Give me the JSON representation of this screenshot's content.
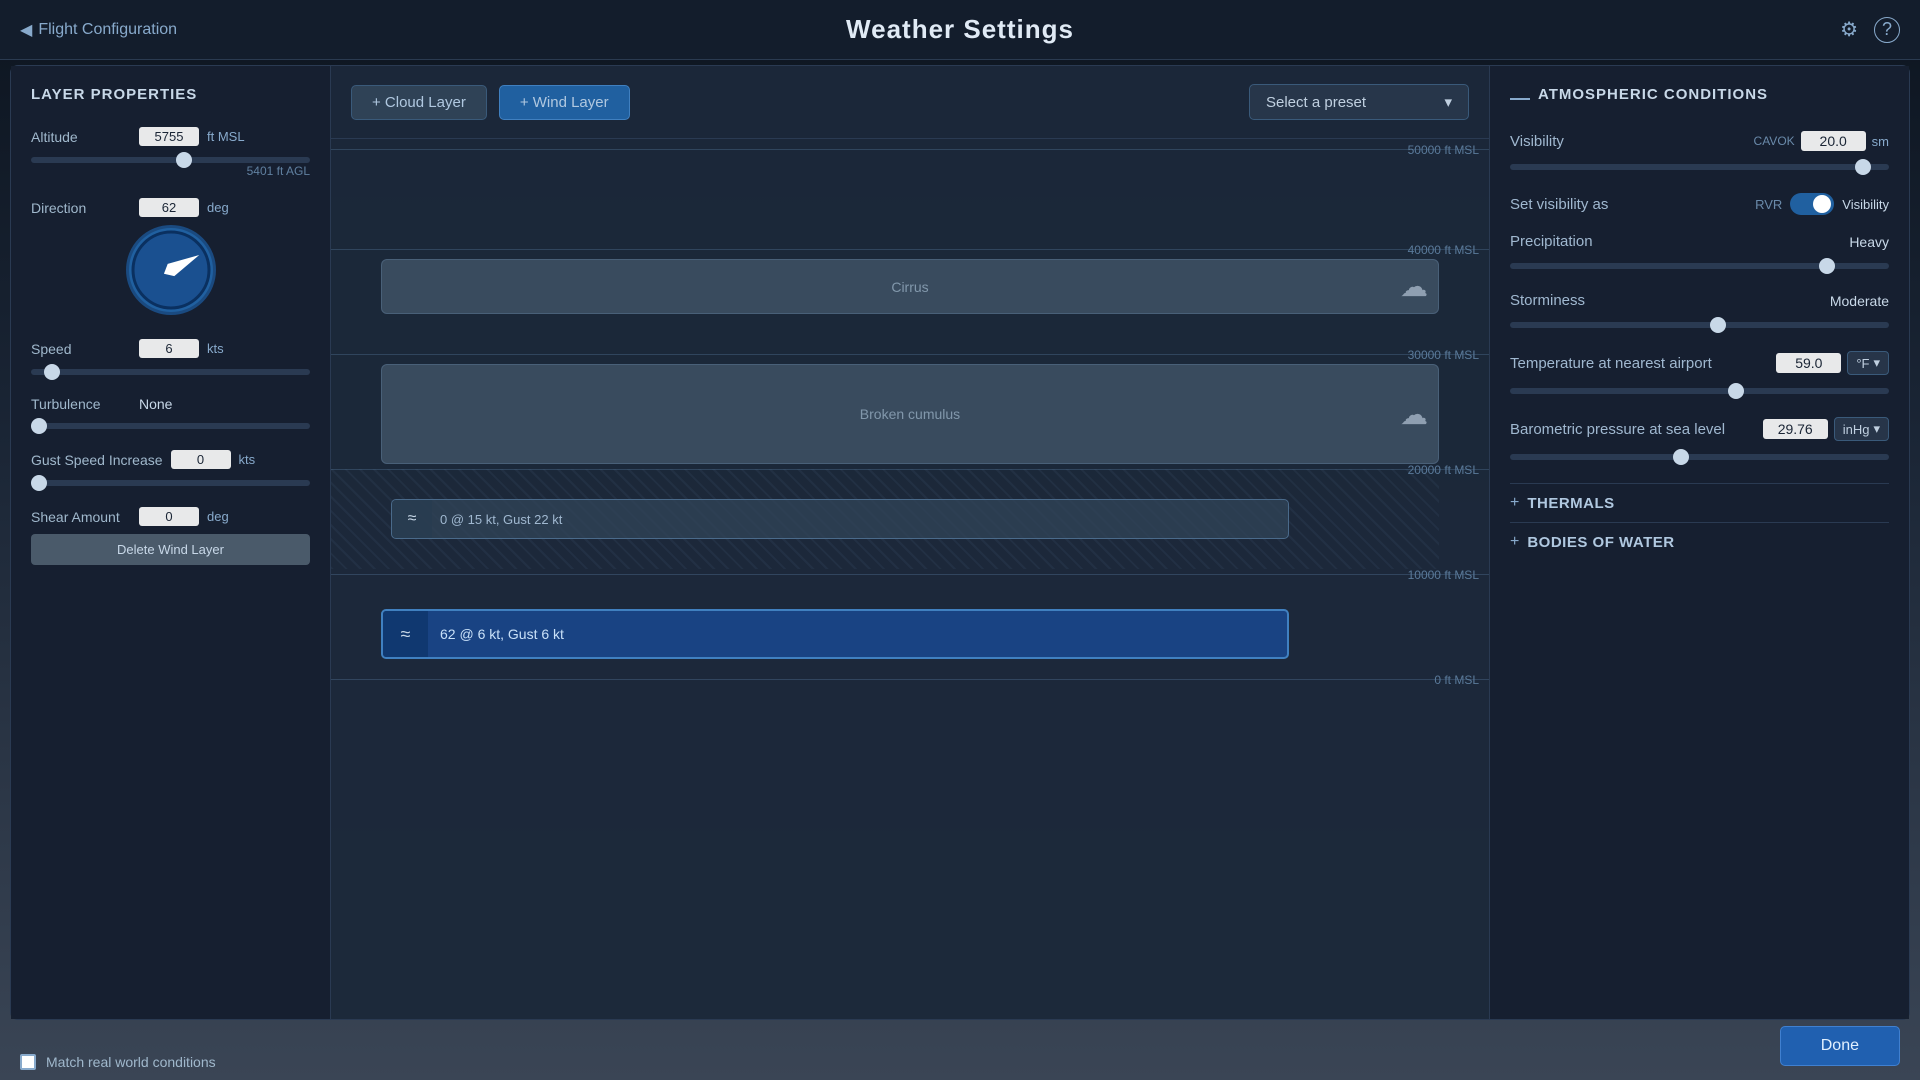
{
  "topBar": {
    "backLabel": "Flight Configuration",
    "title": "Weather Settings",
    "backIcon": "◀"
  },
  "leftPanel": {
    "sectionTitle": "LAYER PROPERTIES",
    "altitude": {
      "label": "Altitude",
      "value": "5755",
      "unit": "ft MSL",
      "subLabel": "5401 ft AGL",
      "sliderPercent": 55
    },
    "direction": {
      "label": "Direction",
      "value": "62",
      "unit": "deg",
      "compassAngle": 62
    },
    "speed": {
      "label": "Speed",
      "value": "6",
      "unit": "kts",
      "sliderPercent": 5
    },
    "turbulence": {
      "label": "Turbulence",
      "value": "None",
      "sliderPercent": 0
    },
    "gustSpeed": {
      "label": "Gust Speed Increase",
      "value": "0",
      "unit": "kts",
      "sliderPercent": 0
    },
    "shearAmount": {
      "label": "Shear Amount",
      "value": "0",
      "unit": "deg"
    },
    "deleteBtn": "Delete Wind Layer",
    "matchRealWorld": "Match real world conditions"
  },
  "centerPanel": {
    "cloudLayerBtn": "+ Cloud Layer",
    "windLayerBtn": "+ Wind Layer",
    "presetLabel": "Select a preset",
    "altitudeLabels": {
      "50000": "50000 ft MSL",
      "40000": "40000 ft MSL",
      "30000": "30000 ft MSL",
      "20000": "20000 ft MSL",
      "10000": "10000 ft MSL",
      "0": "0 ft MSL"
    },
    "cirrusLayer": "Cirrus",
    "brokenCumulusLayer": "Broken cumulus",
    "windLayerInfo": "0 @ 15 kt, Gust 22 kt",
    "activeWindLayer": "62 @ 6 kt, Gust 6 kt"
  },
  "rightPanel": {
    "sectionTitle": "ATMOSPHERIC CONDITIONS",
    "visibility": {
      "label": "Visibility",
      "value": "20.0",
      "unit": "sm",
      "sliderPercent": 95,
      "cavokLabel": "CAVOK"
    },
    "setVisibilityAs": {
      "label": "Set visibility as",
      "rvrLabel": "RVR",
      "visibilityLabel": "Visibility"
    },
    "precipitation": {
      "label": "Precipitation",
      "value": "Heavy",
      "sliderPercent": 85
    },
    "storminess": {
      "label": "Storminess",
      "value": "Moderate",
      "sliderPercent": 55
    },
    "temperature": {
      "label": "Temperature at nearest airport",
      "value": "59.0",
      "unit": "°F",
      "sliderPercent": 60
    },
    "barometric": {
      "label": "Barometric pressure at sea level",
      "value": "29.76",
      "unit": "inHg",
      "sliderPercent": 45
    },
    "thermals": {
      "label": "THERMALS"
    },
    "bodiesOfWater": {
      "label": "BODIES OF WATER"
    }
  },
  "doneBtn": "Done",
  "icons": {
    "back": "◀",
    "settings": "⚙",
    "help": "?",
    "chevronDown": "▾",
    "wind": "≈",
    "cloud": "☁",
    "plus": "+"
  }
}
